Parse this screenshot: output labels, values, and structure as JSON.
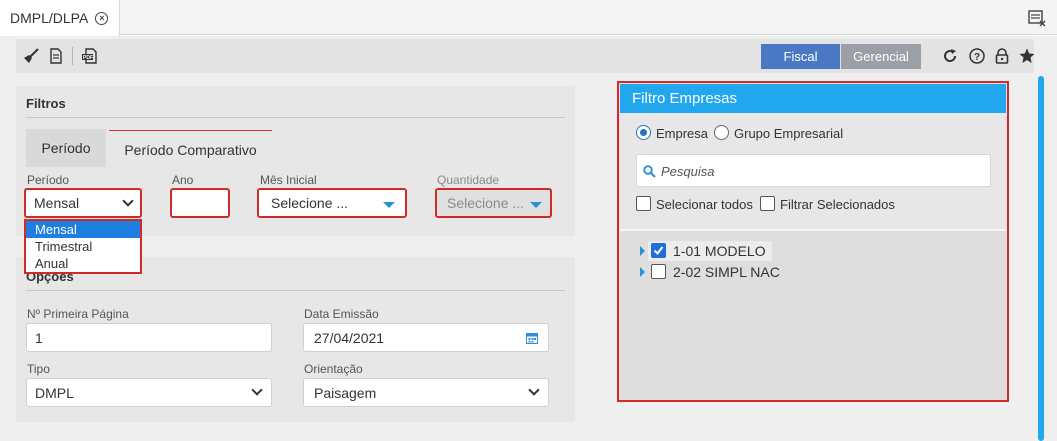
{
  "tab": {
    "title": "DMPL/DLPA",
    "close_icon": "close-circle-icon"
  },
  "toolbar": {
    "left_icons": [
      "broom-icon",
      "document-icon",
      "pdf-icon"
    ],
    "fiscal_label": "Fiscal",
    "gerencial_label": "Gerencial",
    "right_icons": [
      "refresh-icon",
      "help-icon",
      "lock-icon",
      "star-icon"
    ]
  },
  "filtros": {
    "title": "Filtros",
    "tabs": [
      {
        "label": "Período",
        "active": false
      },
      {
        "label": "Período Comparativo",
        "active": true
      }
    ],
    "periodo": {
      "label": "Período",
      "value": "Mensal",
      "options": [
        "Mensal",
        "Trimestral",
        "Anual"
      ],
      "selected": "Mensal"
    },
    "ano": {
      "label": "Ano",
      "value": ""
    },
    "mes_inicial": {
      "label": "Mês Inicial",
      "value": "Selecione ..."
    },
    "quantidade": {
      "label": "Quantidade",
      "value": "Selecione ..."
    }
  },
  "opcoes": {
    "title": "Opções",
    "primeira_pagina": {
      "label": "Nº Primeira Página",
      "value": "1"
    },
    "data_emissao": {
      "label": "Data Emissão",
      "value": "27/04/2021"
    },
    "tipo": {
      "label": "Tipo",
      "value": "DMPL"
    },
    "orientacao": {
      "label": "Orientação",
      "value": "Paisagem"
    }
  },
  "filtro_empresas": {
    "title": "Filtro Empresas",
    "radio_empresa": "Empresa",
    "radio_grupo": "Grupo Empresarial",
    "selected_radio": "Empresa",
    "search_placeholder": "Pesquisa",
    "selecionar_todos": "Selecionar todos",
    "filtrar_selecionados": "Filtrar Selecionados",
    "items": [
      {
        "label": "1-01 MODELO",
        "checked": true
      },
      {
        "label": "2-02 SIMPL NAC",
        "checked": false
      }
    ]
  },
  "colors": {
    "accent_blue": "#21a7ee",
    "fiscal_blue": "#4a78c2",
    "highlight_red": "#d12a2a"
  }
}
